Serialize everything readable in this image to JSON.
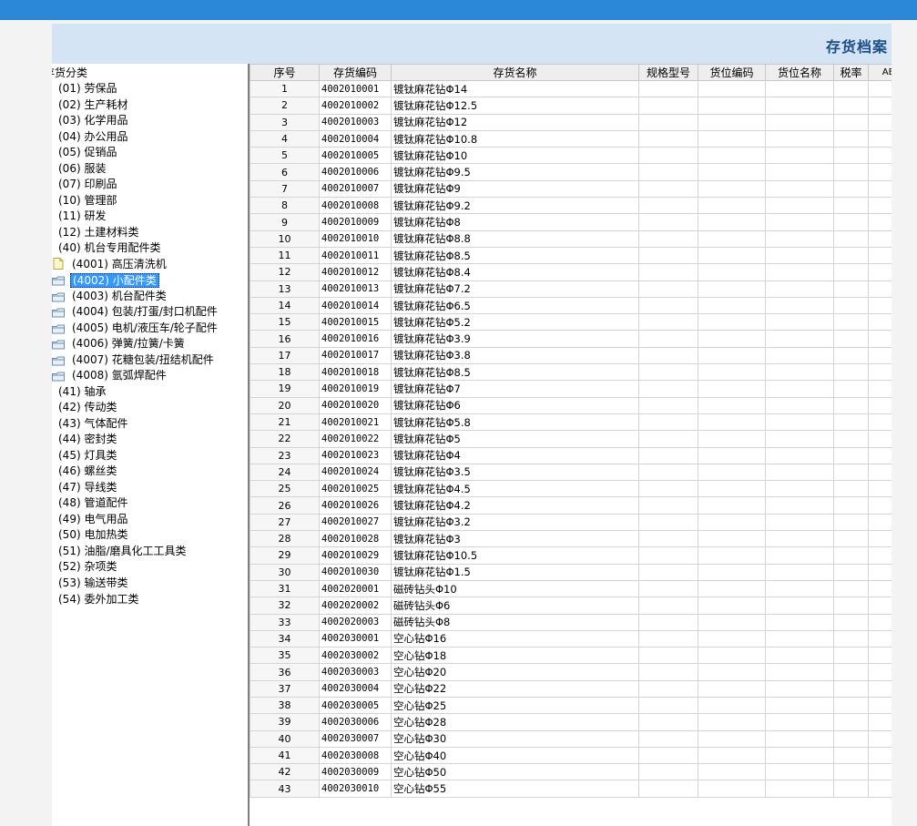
{
  "app": {
    "title": "存货档案"
  },
  "tree": {
    "root": "存货分类",
    "items": [
      {
        "label": "(01) 劳保品",
        "level": 0
      },
      {
        "label": "(02) 生产耗材",
        "level": 0
      },
      {
        "label": "(03) 化学用品",
        "level": 0
      },
      {
        "label": "(04) 办公用品",
        "level": 0
      },
      {
        "label": "(05) 促销品",
        "level": 0
      },
      {
        "label": "(06) 服装",
        "level": 0
      },
      {
        "label": "(07) 印刷品",
        "level": 0
      },
      {
        "label": "(10) 管理部",
        "level": 0
      },
      {
        "label": "(11) 研发",
        "level": 0
      },
      {
        "label": "(12) 土建材料类",
        "level": 0
      },
      {
        "label": "(40) 机台专用配件类",
        "level": 0
      },
      {
        "label": "(4001) 高压清洗机",
        "level": 1,
        "icon": "file-icon"
      },
      {
        "label": "(4002) 小配件类",
        "level": 1,
        "icon": "folder-icon",
        "selected": true
      },
      {
        "label": "(4003) 机台配件类",
        "level": 1,
        "icon": "folder-icon"
      },
      {
        "label": "(4004) 包装/打蛋/封口机配件",
        "level": 1,
        "icon": "folder-icon"
      },
      {
        "label": "(4005) 电机/液压车/轮子配件",
        "level": 1,
        "icon": "folder-icon"
      },
      {
        "label": "(4006) 弹簧/拉簧/卡簧",
        "level": 1,
        "icon": "folder-icon"
      },
      {
        "label": "(4007) 花糖包装/扭结机配件",
        "level": 1,
        "icon": "folder-icon"
      },
      {
        "label": "(4008) 氩弧焊配件",
        "level": 1,
        "icon": "folder-icon"
      },
      {
        "label": "(41) 轴承",
        "level": 0
      },
      {
        "label": "(42) 传动类",
        "level": 0
      },
      {
        "label": "(43) 气体配件",
        "level": 0
      },
      {
        "label": "(44) 密封类",
        "level": 0
      },
      {
        "label": "(45) 灯具类",
        "level": 0
      },
      {
        "label": "(46) 螺丝类",
        "level": 0
      },
      {
        "label": "(47) 导线类",
        "level": 0
      },
      {
        "label": "(48) 管道配件",
        "level": 0
      },
      {
        "label": "(49) 电气用品",
        "level": 0
      },
      {
        "label": "(50) 电加热类",
        "level": 0
      },
      {
        "label": "(51) 油脂/磨具化工工具类",
        "level": 0
      },
      {
        "label": "(52) 杂项类",
        "level": 0
      },
      {
        "label": "(53) 输送带类",
        "level": 0
      },
      {
        "label": "(54) 委外加工类",
        "level": 0
      }
    ]
  },
  "grid": {
    "columns": [
      "序号",
      "存货编码",
      "存货名称",
      "规格型号",
      "货位编码",
      "货位名称",
      "税率",
      "ABC"
    ],
    "rows": [
      [
        "1",
        "4002010001",
        "镀钛麻花钻Φ14"
      ],
      [
        "2",
        "4002010002",
        "镀钛麻花钻Φ12.5"
      ],
      [
        "3",
        "4002010003",
        "镀钛麻花钻Φ12"
      ],
      [
        "4",
        "4002010004",
        "镀钛麻花钻Φ10.8"
      ],
      [
        "5",
        "4002010005",
        "镀钛麻花钻Φ10"
      ],
      [
        "6",
        "4002010006",
        "镀钛麻花钻Φ9.5"
      ],
      [
        "7",
        "4002010007",
        "镀钛麻花钻Φ9"
      ],
      [
        "8",
        "4002010008",
        "镀钛麻花钻Φ9.2"
      ],
      [
        "9",
        "4002010009",
        "镀钛麻花钻Φ8"
      ],
      [
        "10",
        "4002010010",
        "镀钛麻花钻Φ8.8"
      ],
      [
        "11",
        "4002010011",
        "镀钛麻花钻Φ8.5"
      ],
      [
        "12",
        "4002010012",
        "镀钛麻花钻Φ8.4"
      ],
      [
        "13",
        "4002010013",
        "镀钛麻花钻Φ7.2"
      ],
      [
        "14",
        "4002010014",
        "镀钛麻花钻Φ6.5"
      ],
      [
        "15",
        "4002010015",
        "镀钛麻花钻Φ5.2"
      ],
      [
        "16",
        "4002010016",
        "镀钛麻花钻Φ3.9"
      ],
      [
        "17",
        "4002010017",
        "镀钛麻花钻Φ3.8"
      ],
      [
        "18",
        "4002010018",
        "镀钛麻花钻Φ8.5"
      ],
      [
        "19",
        "4002010019",
        "镀钛麻花钻Φ7"
      ],
      [
        "20",
        "4002010020",
        "镀钛麻花钻Φ6"
      ],
      [
        "21",
        "4002010021",
        "镀钛麻花钻Φ5.8"
      ],
      [
        "22",
        "4002010022",
        "镀钛麻花钻Φ5"
      ],
      [
        "23",
        "4002010023",
        "镀钛麻花钻Φ4"
      ],
      [
        "24",
        "4002010024",
        "镀钛麻花钻Φ3.5"
      ],
      [
        "25",
        "4002010025",
        "镀钛麻花钻Φ4.5"
      ],
      [
        "26",
        "4002010026",
        "镀钛麻花钻Φ4.2"
      ],
      [
        "27",
        "4002010027",
        "镀钛麻花钻Φ3.2"
      ],
      [
        "28",
        "4002010028",
        "镀钛麻花钻Φ3"
      ],
      [
        "29",
        "4002010029",
        "镀钛麻花钻Φ10.5"
      ],
      [
        "30",
        "4002010030",
        "镀钛麻花钻Φ1.5"
      ],
      [
        "31",
        "4002020001",
        "磁砖钻头Φ10"
      ],
      [
        "32",
        "4002020002",
        "磁砖钻头Φ6"
      ],
      [
        "33",
        "4002020003",
        "磁砖钻头Φ8"
      ],
      [
        "34",
        "4002030001",
        "空心钻Φ16"
      ],
      [
        "35",
        "4002030002",
        "空心钻Φ18"
      ],
      [
        "36",
        "4002030003",
        "空心钻Φ20"
      ],
      [
        "37",
        "4002030004",
        "空心钻Φ22"
      ],
      [
        "38",
        "4002030005",
        "空心钻Φ25"
      ],
      [
        "39",
        "4002030006",
        "空心钻Φ28"
      ],
      [
        "40",
        "4002030007",
        "空心钻Φ30"
      ],
      [
        "41",
        "4002030008",
        "空心钻Φ40"
      ],
      [
        "42",
        "4002030009",
        "空心钻Φ50"
      ],
      [
        "43",
        "4002030010",
        "空心钻Φ55"
      ]
    ]
  },
  "colors": {
    "topbar": "#2b88d8",
    "header": "#d4e4f4",
    "title": "#1d4e8c",
    "selection": "#3399ff"
  }
}
